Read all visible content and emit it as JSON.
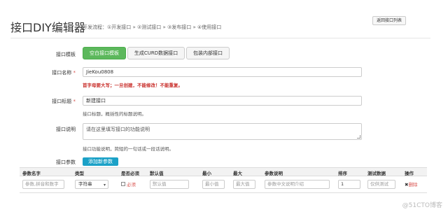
{
  "header": {
    "title": "接口DIY编辑器",
    "subtitle": "开发流程：①开发接口 » ②测试接口 » ③发布接口 » ④使用接口",
    "back_button": "返回接口列表"
  },
  "form": {
    "template": {
      "label": "接口模板",
      "options": [
        "空白接口模板",
        "生成CURD数据接口",
        "包装内部接口"
      ],
      "selected": "空白接口模板"
    },
    "name": {
      "label": "接口名称",
      "required_mark": "*",
      "value": "JieKou0808",
      "warning": "首字母要大写；一旦创建，不能修改！不能重复。"
    },
    "title": {
      "label": "接口标题",
      "required_mark": "*",
      "value": "新建接口",
      "help": "接口标题，概括性的标题说明。"
    },
    "description": {
      "label": "接口说明",
      "placeholder": "请在这里填写接口的功能说明",
      "help": "接口功能说明，简短的一句话或一段话说明。"
    },
    "params": {
      "label": "接口参数",
      "add_button": "添加新参数"
    }
  },
  "table": {
    "columns": [
      "参数名字",
      "类型",
      "是否必须",
      "默认值",
      "最小",
      "最大",
      "参数说明",
      "排序",
      "测试数据",
      "操作"
    ],
    "row": {
      "name_placeholder": "参数,拼音和数字",
      "type_value": "字符串",
      "required_label": "必须",
      "default_placeholder": "默认值",
      "min_placeholder": "最小值",
      "max_placeholder": "最大值",
      "desc_placeholder": "参数中文说明介绍",
      "order_value": "1",
      "test_placeholder": "仅供测试",
      "delete_icon": "✖",
      "delete_label": "删除"
    }
  },
  "watermark": "@51CTO博客"
}
